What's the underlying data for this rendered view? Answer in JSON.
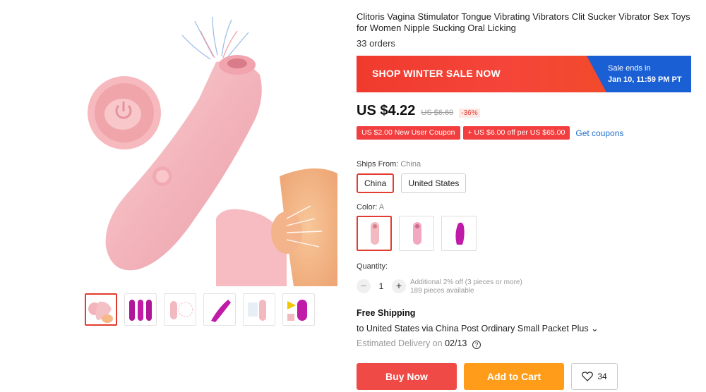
{
  "product": {
    "title": "Clitoris Vagina Stimulator Tongue Vibrating Vibrators Clit Sucker Vibrator Sex Toys for Women Nipple Sucking Oral Licking",
    "orders": "33 orders"
  },
  "banner": {
    "left_text": "SHOP WINTER SALE NOW",
    "right_line1": "Sale ends in",
    "right_line2": "Jan 10, 11:59 PM PT"
  },
  "price": {
    "current": "US $4.22",
    "old": "US $6.60",
    "discount": "-36%"
  },
  "coupons": {
    "items": [
      "US $2.00 New User Coupon",
      "+ US $6.00 off per US $65.00"
    ],
    "link": "Get coupons"
  },
  "ships_from": {
    "label": "Ships From:",
    "value": "China",
    "options": [
      "China",
      "United States"
    ]
  },
  "color": {
    "label": "Color:",
    "value": "A"
  },
  "quantity": {
    "label": "Quantity:",
    "minus": "−",
    "plus": "+",
    "value": "1",
    "note1": "Additional 2% off (3 pieces or more)",
    "note2": "189 pieces available"
  },
  "shipping": {
    "free": "Free Shipping",
    "via": "to United States via China Post Ordinary Small Packet Plus",
    "chevron": "⌄",
    "delivery_label": "Estimated Delivery on",
    "delivery_date": "02/13",
    "help_icon": "?"
  },
  "actions": {
    "buy": "Buy Now",
    "cart": "Add to Cart",
    "wish_count": "34"
  },
  "colors": {
    "accent_red": "#e23b2f",
    "banner_blue": "#1a5fd3",
    "cart_orange": "#ff9c1a",
    "product_pink": "#f3b9c0",
    "product_magenta": "#c01aa8"
  }
}
